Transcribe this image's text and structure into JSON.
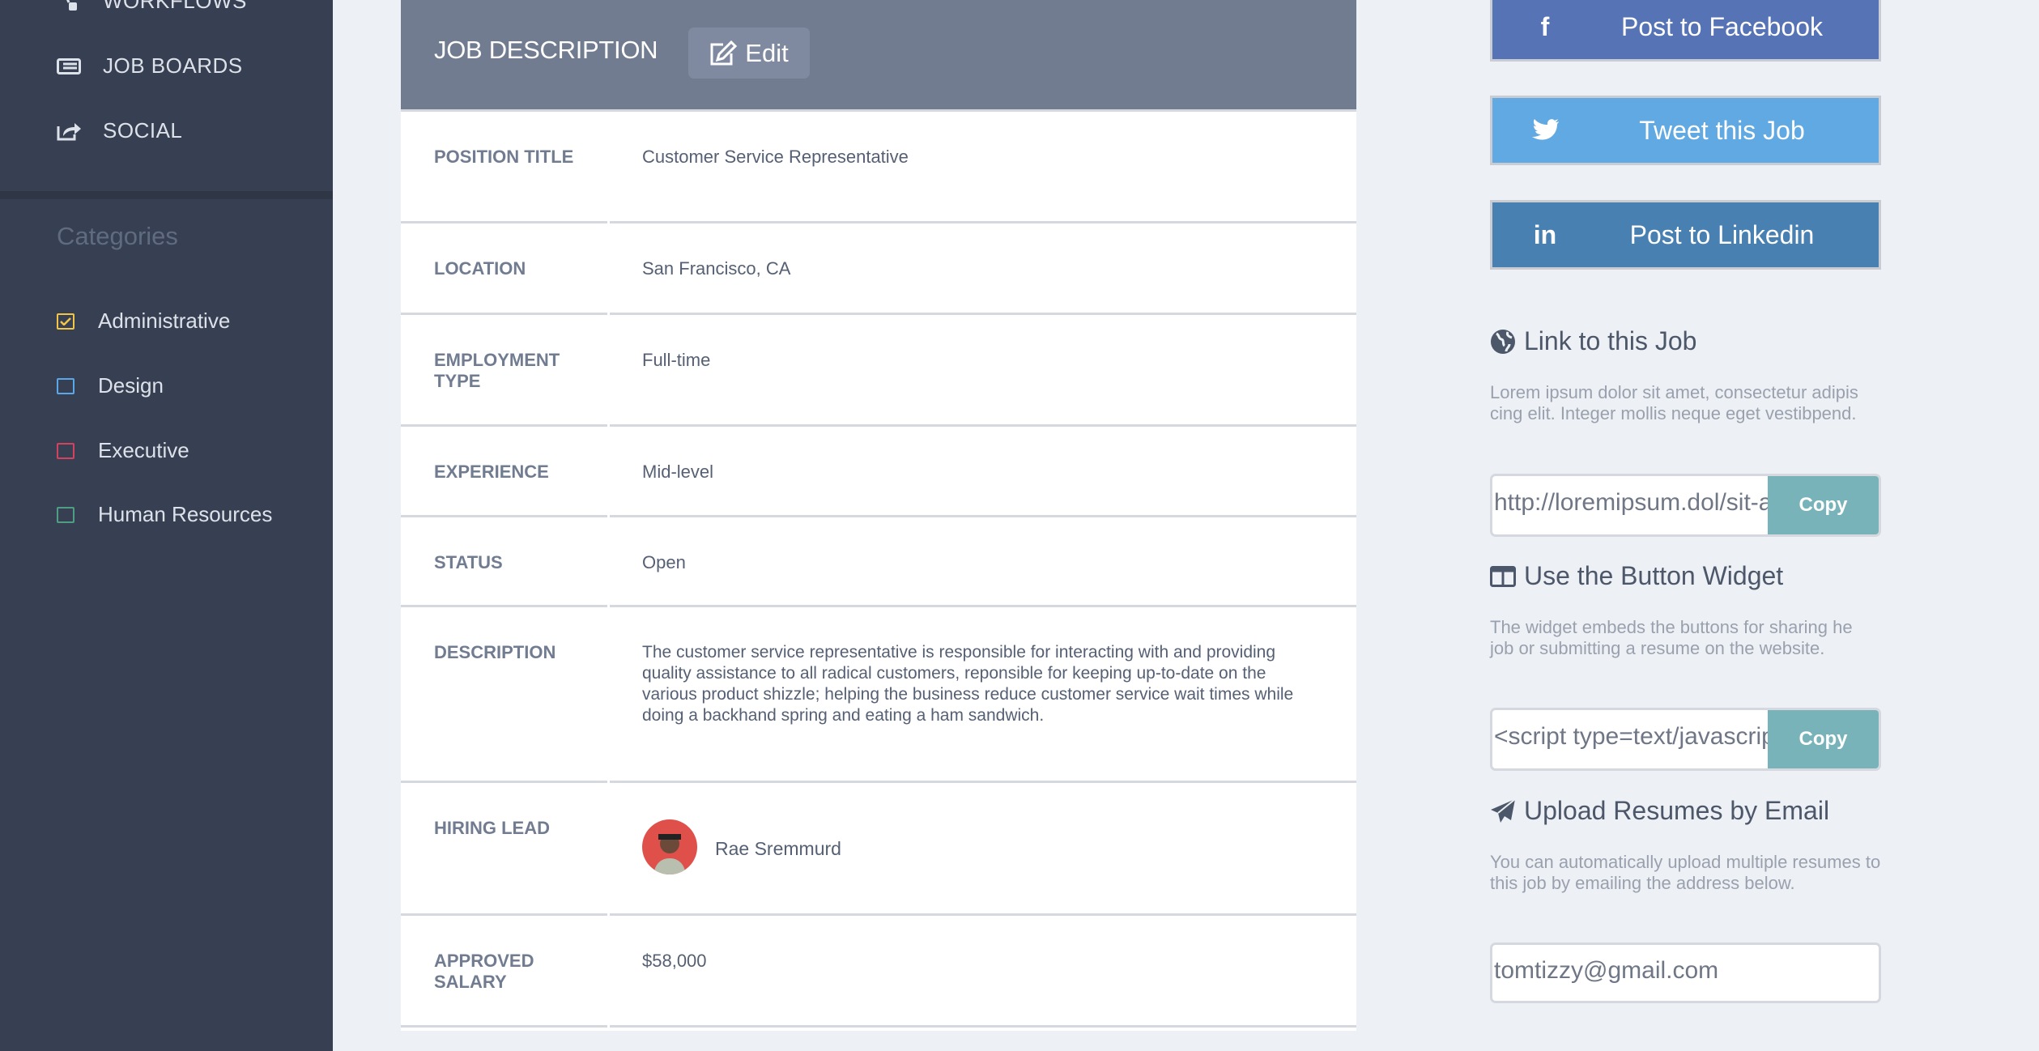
{
  "sidebar": {
    "nav": [
      {
        "label": "WORKFLOWS",
        "icon": "sitemap-icon"
      },
      {
        "label": "JOB BOARDS",
        "icon": "newspaper-icon"
      },
      {
        "label": "SOCIAL",
        "icon": "share-icon"
      }
    ],
    "categories_title": "Categories",
    "categories": [
      {
        "label": "Administrative",
        "color": "#f3c545",
        "checked": true
      },
      {
        "label": "Design",
        "color": "#5aa8e8",
        "checked": false
      },
      {
        "label": "Executive",
        "color": "#d3435f",
        "checked": false
      },
      {
        "label": "Human Resources",
        "color": "#4f9d83",
        "checked": false
      }
    ]
  },
  "card": {
    "title": "JOB DESCRIPTION",
    "edit_label": "Edit",
    "rows": [
      {
        "label": "POSITION TITLE",
        "value": "Customer Service Representative"
      },
      {
        "label": "LOCATION",
        "value": "San Francisco, CA"
      },
      {
        "label": "EMPLOYMENT TYPE",
        "value": "Full-time"
      },
      {
        "label": "EXPERIENCE",
        "value": "Mid-level"
      },
      {
        "label": "STATUS",
        "value": "Open"
      },
      {
        "label": "DESCRIPTION",
        "value": "The customer service representative is responsible for interacting with and providing quality assistance to all radical customers, reponsible for keeping up-to-date on the various product shizzle; helping the business reduce customer service wait times while doing a backhand spring and eating a ham sandwich."
      },
      {
        "label": "HIRING LEAD",
        "value": "Rae Sremmurd"
      },
      {
        "label": "APPROVED SALARY",
        "value": "$58,000"
      }
    ]
  },
  "share": {
    "facebook": {
      "label": "Post to Facebook",
      "color": "#5673b6"
    },
    "twitter": {
      "label": "Tweet this Job",
      "color": "#60a9e2"
    },
    "linkedin": {
      "label": "Post to Linkedin",
      "color": "#4880b2"
    },
    "link": {
      "title": "Link to this Job",
      "text": "Lorem ipsum dolor sit amet, consectetur adipis cing elit. Integer mollis neque eget vestibpend.",
      "value": "http://loremipsum.dol/sit-amet",
      "copy": "Copy"
    },
    "widget": {
      "title": "Use the Button Widget",
      "text": "The widget embeds the buttons for sharing he job or submitting a resume on the website.",
      "value": "<script type=text/javascript>",
      "copy": "Copy"
    },
    "upload": {
      "title": "Upload Resumes by Email",
      "text": "You can automatically upload multiple resumes to this job by emailing the address below.",
      "value": "tomtizzy@gmail.com"
    }
  }
}
